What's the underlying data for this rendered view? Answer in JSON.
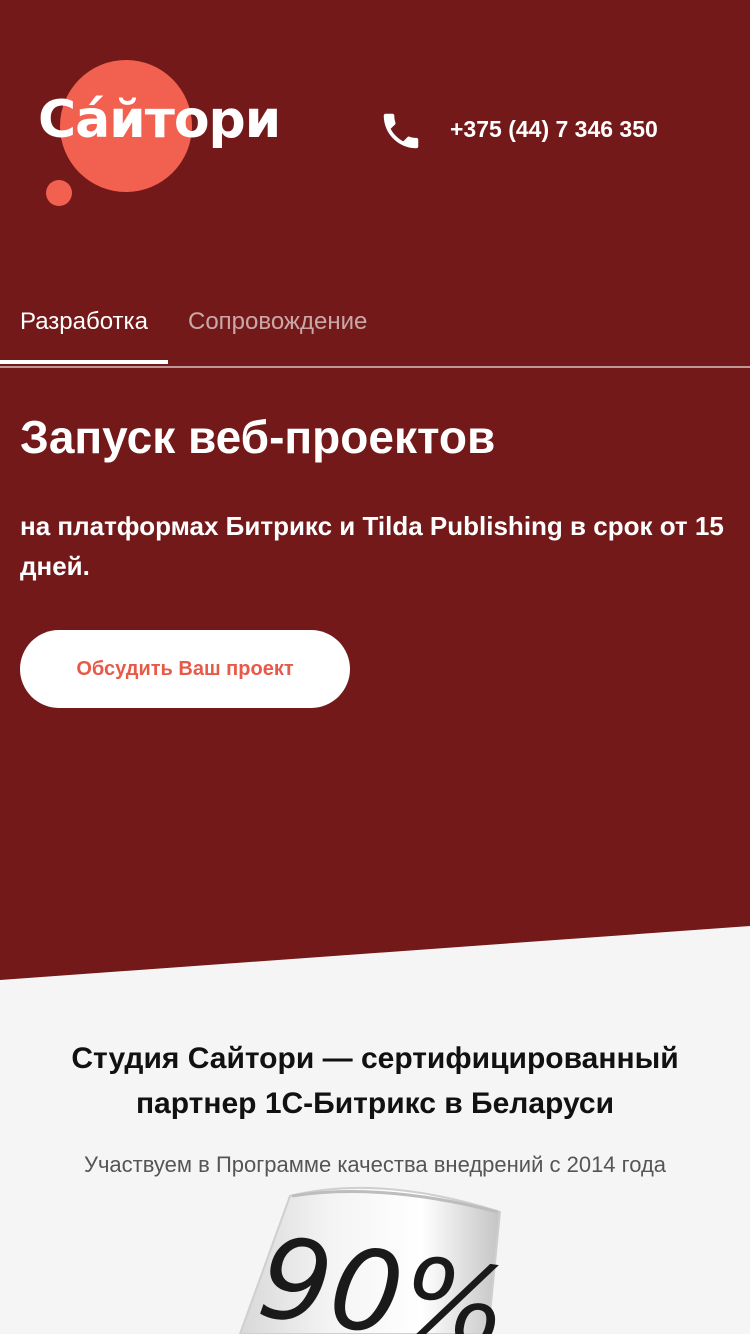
{
  "colors": {
    "hero_bg": "#731919",
    "accent": "#f26150",
    "page_bg": "#f5f5f5",
    "cta_text": "#e85a48"
  },
  "header": {
    "logo_text": "Са́йтори",
    "phone_icon": "phone-icon",
    "phone": "+375 (44) 7 346 350"
  },
  "tabs": [
    {
      "label": "Разработка",
      "active": true
    },
    {
      "label": "Сопровождение",
      "active": false
    }
  ],
  "hero": {
    "title": "Запуск веб-проектов",
    "subtitle": "на платформах Битрикс и Tilda Publishing в срок от 15 дней.",
    "cta_label": "Обсудить Ваш проект"
  },
  "partner": {
    "title": "Студия Сайтори — сертифицированный партнер 1С-Битрикс в Беларуси",
    "subtitle": "Участвуем в Программе качества внедрений с 2014 года",
    "image_label": "90%"
  }
}
